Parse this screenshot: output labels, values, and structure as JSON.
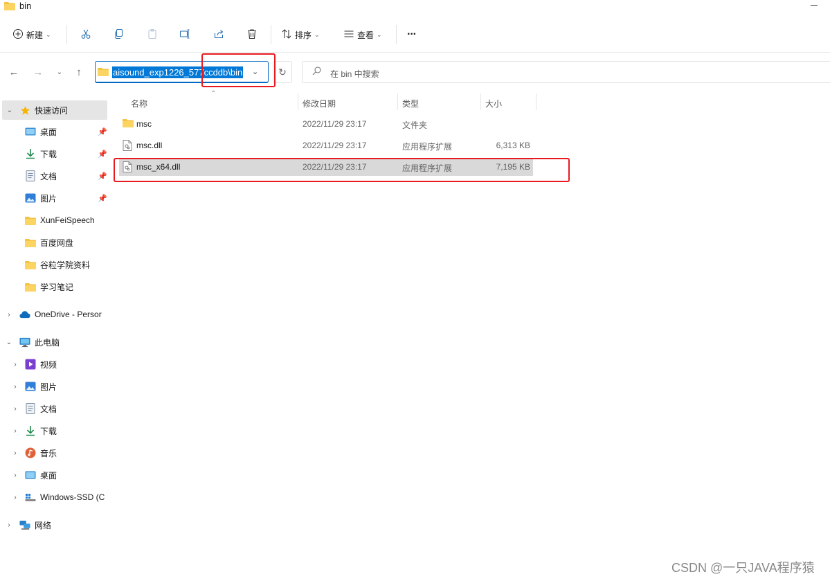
{
  "window": {
    "title": "bin"
  },
  "toolbar": {
    "new_label": "新建",
    "sort_label": "排序",
    "view_label": "查看",
    "more_label": "···"
  },
  "nav": {
    "address_path": "aisound_exp1226_577ccddb\\bin",
    "search_placeholder": "在 bin 中搜索"
  },
  "sidebar": {
    "quick_access": "快速访问",
    "quick_items": [
      "桌面",
      "下载",
      "文档",
      "图片",
      "XunFeiSpeech",
      "百度网盘",
      "谷粒学院资料",
      "学习笔记"
    ],
    "onedrive": "OneDrive - Persor",
    "this_pc": "此电脑",
    "pc_items": [
      "视频",
      "图片",
      "文档",
      "下载",
      "音乐",
      "桌面",
      "Windows-SSD (C"
    ],
    "network": "网络"
  },
  "columns": {
    "name": "名称",
    "modified": "修改日期",
    "type": "类型",
    "size": "大小"
  },
  "files": [
    {
      "name": "msc",
      "modified": "2022/11/29 23:17",
      "type": "文件夹",
      "size": "",
      "icon": "folder-icon"
    },
    {
      "name": "msc.dll",
      "modified": "2022/11/29 23:17",
      "type": "应用程序扩展",
      "size": "6,313 KB",
      "icon": "dll-file-icon"
    },
    {
      "name": "msc_x64.dll",
      "modified": "2022/11/29 23:17",
      "type": "应用程序扩展",
      "size": "7,195 KB",
      "icon": "dll-file-icon",
      "selected": true
    }
  ],
  "watermark": "CSDN @一只JAVA程序猿",
  "colors": {
    "accent": "#0078d7",
    "annotation": "#e8191f",
    "folder": "#f5c242"
  }
}
